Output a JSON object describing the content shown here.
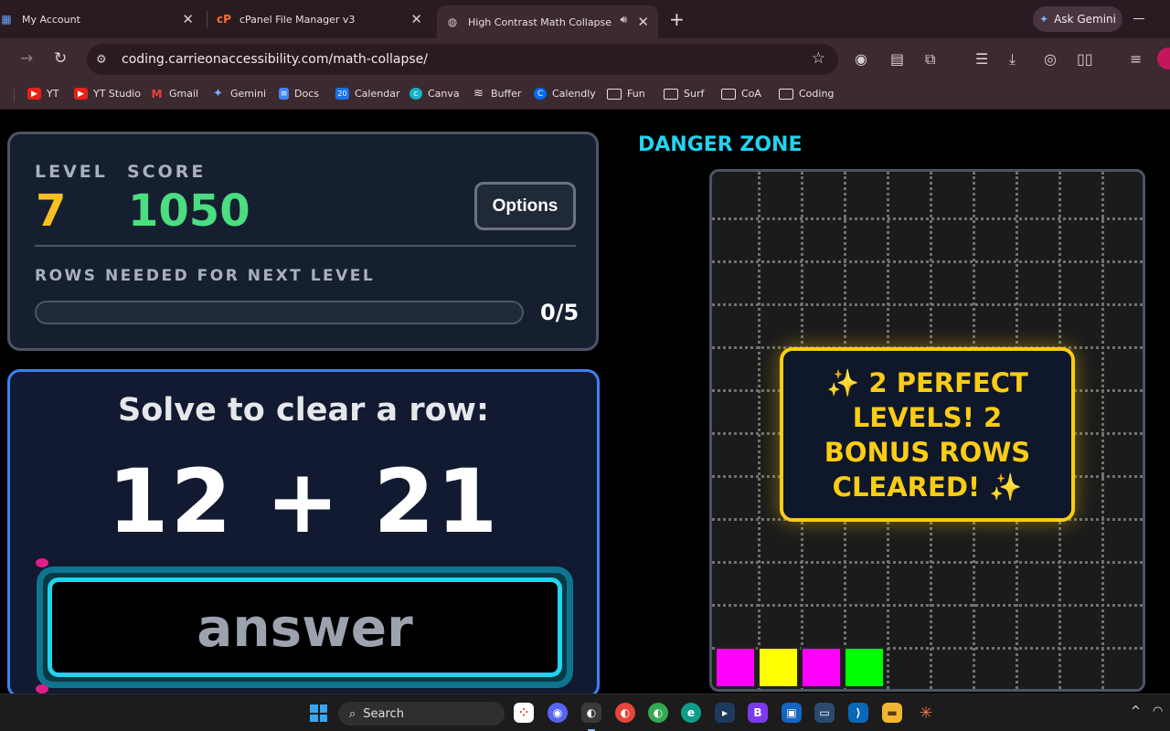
{
  "browser": {
    "tabs": [
      {
        "title": "My Account",
        "favicon": "grid-icon"
      },
      {
        "title": "cPanel File Manager v3",
        "favicon": "cpanel-icon"
      },
      {
        "title": "High Contrast Math Collapse",
        "favicon": "globe-icon",
        "active": true
      }
    ],
    "ask_gemini": "Ask Gemini",
    "url": "coding.carrieonaccessibility.com/math-collapse/",
    "bookmarks": [
      "YT",
      "YT Studio",
      "Gmail",
      "Gemini",
      "Docs",
      "Calendar",
      "Canva",
      "Buffer",
      "Calendly",
      "Fun",
      "Surf",
      "CoA",
      "Coding"
    ],
    "calendar_icon_text": "20"
  },
  "game": {
    "level_label": "LEVEL",
    "level": "7",
    "score_label": "SCORE",
    "score": "1050",
    "options_label": "Options",
    "rows_label": "ROWS NEEDED FOR NEXT LEVEL",
    "rows_progress": "0/5",
    "rows_fraction": 0,
    "solve_title": "Solve to clear a row:",
    "problem": "12 + 21",
    "answer_placeholder": "answer",
    "danger_title": "DANGER ZONE",
    "toast": "✨ 2 PERFECT LEVELS! 2 BONUS ROWS CLEARED! ✨",
    "board_blocks": [
      {
        "col": 0,
        "color": "#ff00ff"
      },
      {
        "col": 1,
        "color": "#ffff00"
      },
      {
        "col": 2,
        "color": "#ff00ff"
      },
      {
        "col": 3,
        "color": "#00ff00"
      }
    ],
    "colors": {
      "level": "#fbbf24",
      "score": "#4ade80",
      "accent": "#22d3ee",
      "toast": "#facc15",
      "panel_border": "#3b82f6"
    }
  },
  "taskbar": {
    "search_label": "Search"
  }
}
